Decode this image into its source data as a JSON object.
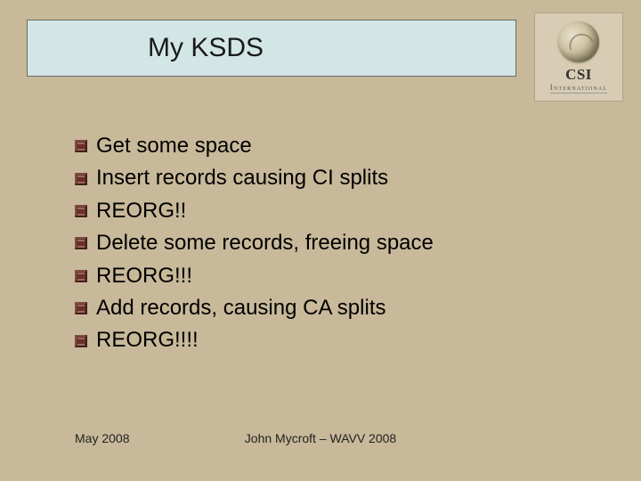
{
  "title": "My KSDS",
  "logo": {
    "main": "CSI",
    "sub": "International"
  },
  "bullets": [
    "Get some space",
    "Insert records causing CI splits",
    "REORG!!",
    "Delete some records, freeing space",
    "REORG!!!",
    "Add records, causing CA splits",
    "REORG!!!!"
  ],
  "footer": {
    "left": "May 2008",
    "center": "John Mycroft – WAVV 2008"
  }
}
